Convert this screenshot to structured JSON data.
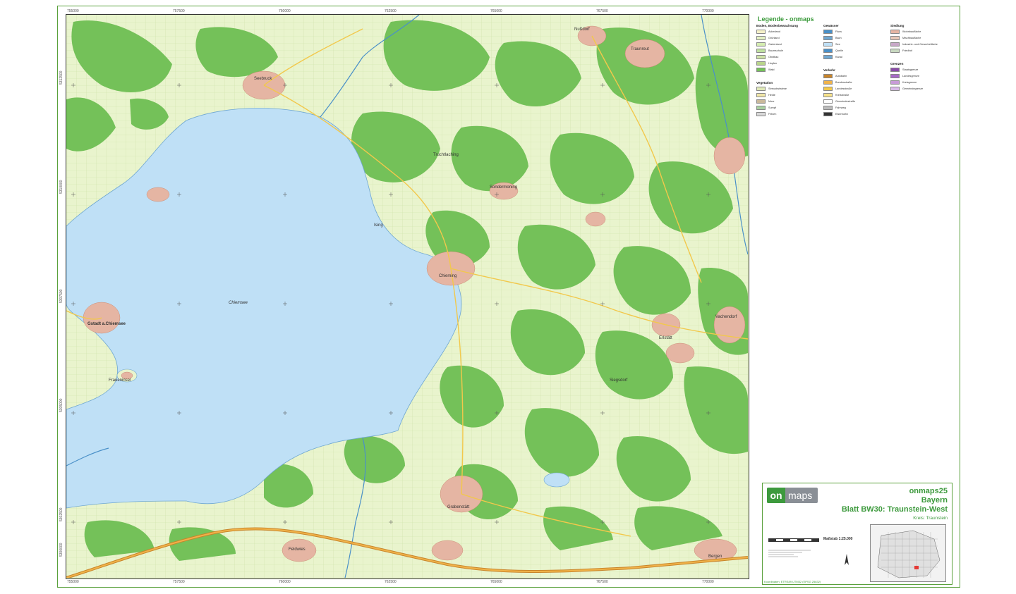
{
  "map": {
    "lake_label": "Chiemsee",
    "places": [
      {
        "id": "seebruck",
        "label": "Seebruck"
      },
      {
        "id": "gstadt",
        "label": "Gstadt a.Chiemsee"
      },
      {
        "id": "frauen",
        "label": "Fraueninsel"
      },
      {
        "id": "chieming",
        "label": "Chieming"
      },
      {
        "id": "grabenstatt",
        "label": "Grabenstätt"
      },
      {
        "id": "truchtlaching",
        "label": "Truchtlaching"
      },
      {
        "id": "nussdorf",
        "label": "Nußdorf"
      },
      {
        "id": "traunreut",
        "label": "Traunreut"
      },
      {
        "id": "erlstaett",
        "label": "Erlstätt"
      },
      {
        "id": "vachendorf",
        "label": "Vachendorf"
      },
      {
        "id": "sondermoning",
        "label": "Sondermoning"
      },
      {
        "id": "ising",
        "label": "Ising"
      },
      {
        "id": "feldwies",
        "label": "Feldwies"
      },
      {
        "id": "bergen",
        "label": "Bergen"
      },
      {
        "id": "siegsdorf",
        "label": "Siegsdorf"
      }
    ],
    "grid_x_labels": [
      "755000",
      "757500",
      "760000",
      "762500",
      "765000",
      "767500",
      "770000"
    ],
    "grid_y_labels": [
      "5312500",
      "5310000",
      "5307500",
      "5305000",
      "5302500",
      "5300000"
    ]
  },
  "legend": {
    "title": "Legende - onmaps",
    "sections": [
      {
        "heading": "Boden, Bodenbewachsung",
        "items": [
          "Ackerland",
          "Grünland",
          "Gartenland",
          "Baumschule",
          "Obstbau",
          "Hopfen",
          "Wald"
        ]
      },
      {
        "heading": "Vegetation",
        "items": [
          "Streuobstwiese",
          "Heide",
          "Moor",
          "Sumpf",
          "Felsen"
        ]
      },
      {
        "heading": "Gewässer",
        "items": [
          "Fluss",
          "Bach",
          "See",
          "Quelle",
          "Kanal"
        ]
      },
      {
        "heading": "Verkehr",
        "items": [
          "Autobahn",
          "Bundesstraße",
          "Landesstraße",
          "Kreisstraße",
          "Gemeindestraße",
          "Fahrweg",
          "Eisenbahn"
        ]
      },
      {
        "heading": "Siedlung",
        "items": [
          "Wohnbaufläche",
          "Mischbaufläche",
          "Industrie- und Gewerbefläche",
          "Friedhof"
        ]
      },
      {
        "heading": "Grenzen",
        "items": [
          "Staatsgrenze",
          "Landesgrenze",
          "Kreisgrenze",
          "Gemeindegrenze"
        ]
      }
    ]
  },
  "title_block": {
    "product": "onmaps25",
    "state": "Bayern",
    "sheet": "Blatt BW30: Traunstein-West",
    "kreis": "Kreis: Traunstein",
    "scale": "Maßstab 1:25.000",
    "logo_on": "on",
    "logo_maps": "maps",
    "koordinaten": "Koordinaten: ETRS89 UTM32 (EPSG 25832)"
  },
  "colors": {
    "frame": "#5aa13c",
    "forest": "#74c159",
    "meadow": "#e4f1c4",
    "lake": "#bfe0f6",
    "settlement": "#e5b5a3",
    "motorway": "#e0a030"
  }
}
